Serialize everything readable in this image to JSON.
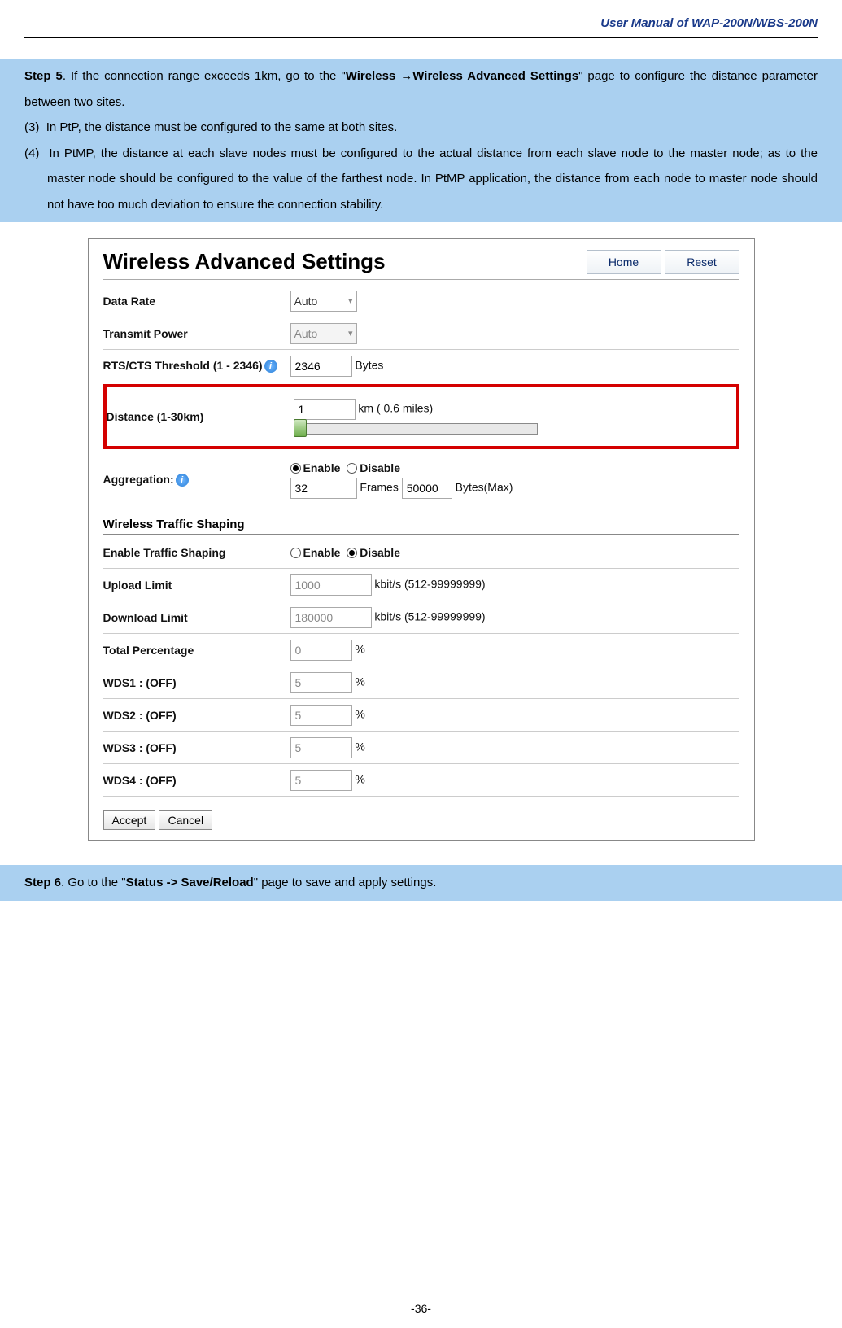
{
  "header": {
    "title": "User Manual of WAP-200N/WBS-200N"
  },
  "step5": {
    "label": "Step 5",
    "intro_pre": ". If the connection range exceeds 1km, go to the \"",
    "bold_path_a": "Wireless ",
    "arrow": "→",
    "bold_path_b": "Wireless Advanced Settings",
    "intro_post": "\" page to configure the distance parameter between two sites.",
    "item3_num": "(3)",
    "item3_text": "In PtP, the distance must be configured to the same at both sites.",
    "item4_num": "(4)",
    "item4_text": "In PtMP, the distance at each slave nodes must be configured to the actual distance from each slave node to the master node; as to the master node should be configured to the value of the farthest node. In PtMP application, the distance from each node to master node should not have too much deviation to ensure the connection stability."
  },
  "panel": {
    "title": "Wireless Advanced Settings",
    "home_btn": "Home",
    "reset_btn": "Reset",
    "rows": {
      "data_rate_lbl": "Data Rate",
      "data_rate_val": "Auto",
      "tx_power_lbl": "Transmit Power",
      "tx_power_val": "Auto",
      "rts_lbl": "RTS/CTS Threshold (1 - 2346)",
      "rts_val": "2346",
      "rts_unit": "Bytes",
      "dist_lbl": "Distance (1-30km)",
      "dist_val": "1",
      "dist_unit": "km  ( 0.6 miles)",
      "aggr_lbl": "Aggregation:",
      "enable": "Enable",
      "disable": "Disable",
      "aggr_frames_val": "32",
      "aggr_frames_unit": "Frames",
      "aggr_bytes_val": "50000",
      "aggr_bytes_unit": "Bytes(Max)",
      "shaping_title": "Wireless Traffic Shaping",
      "shaping_enable_lbl": "Enable Traffic Shaping",
      "upload_lbl": "Upload Limit",
      "upload_val": "1000",
      "upload_unit": "kbit/s (512-99999999)",
      "download_lbl": "Download Limit",
      "download_val": "180000",
      "download_unit": "kbit/s (512-99999999)",
      "total_pct_lbl": "Total Percentage",
      "total_pct_val": "0",
      "pct": "%",
      "wds1_lbl": "WDS1 : (OFF)",
      "wds1_val": "5",
      "wds2_lbl": "WDS2 : (OFF)",
      "wds2_val": "5",
      "wds3_lbl": "WDS3 : (OFF)",
      "wds3_val": "5",
      "wds4_lbl": "WDS4 : (OFF)",
      "wds4_val": "5"
    },
    "accept_btn": "Accept",
    "cancel_btn": "Cancel"
  },
  "step6": {
    "label": "Step 6",
    "pre": ". Go to the \"",
    "bold": "Status -> Save/Reload",
    "post": "\" page to save and apply settings."
  },
  "footer": {
    "page": "-36-"
  }
}
